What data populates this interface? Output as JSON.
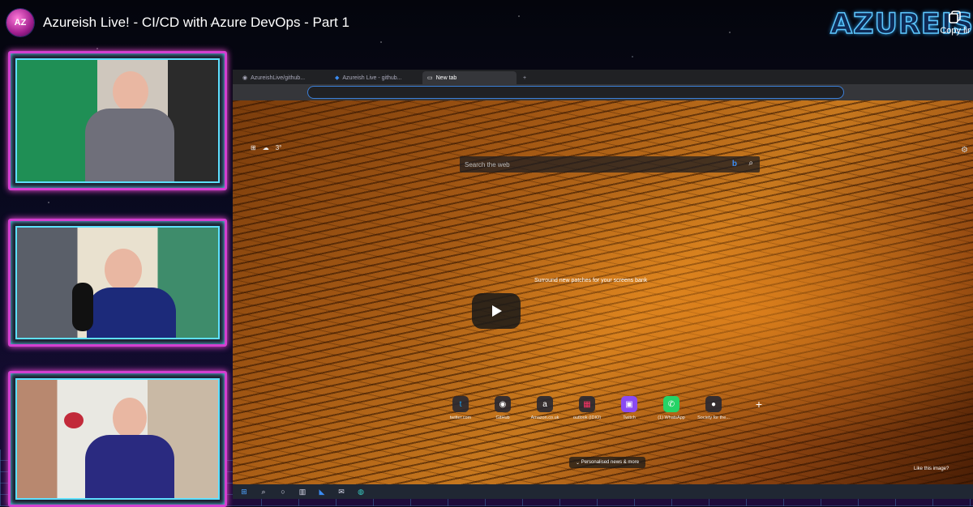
{
  "header": {
    "title": "Azureish Live! - CI/CD with Azure DevOps - Part 1",
    "channel_avatar_text": "AZ",
    "brand_text": "AZUREIS",
    "copy_link_label": "Copy lir"
  },
  "shared_screen": {
    "tabs": [
      {
        "label": "AzureishLive/github..."
      },
      {
        "label": "Azureish Live - github..."
      },
      {
        "label": "New tab"
      }
    ],
    "search_placeholder": "Search the web",
    "widgets_text": "3°",
    "promo_text": "Surround new patches for your screens bank",
    "quick_links": [
      {
        "label": "twitter.com",
        "icon": "twitter-icon",
        "glyph": "t",
        "color": "#1da1f2"
      },
      {
        "label": "GitHub",
        "icon": "github-icon",
        "glyph": "◉",
        "color": "#333"
      },
      {
        "label": "Amazon.co.uk",
        "icon": "amazon-icon",
        "glyph": "a",
        "color": "#222"
      },
      {
        "label": "outlook (IDIO)",
        "icon": "outlook-icon",
        "glyph": "▦",
        "color": "#c33"
      },
      {
        "label": "Twitch",
        "icon": "twitch-icon",
        "glyph": "▣",
        "color": "#8a4af3"
      },
      {
        "label": "(1) WhatsApp",
        "icon": "whatsapp-icon",
        "glyph": "✆",
        "color": "#25d366"
      },
      {
        "label": "Society for the...",
        "icon": "society-icon",
        "glyph": "●",
        "color": "#444"
      }
    ],
    "news_label": "Personalised news & more",
    "like_image_label": "Like this image?"
  },
  "colors": {
    "frame_pink": "#d33fd0",
    "frame_cyan": "#5ee0ff",
    "brand_blue": "#5ec8ff"
  }
}
